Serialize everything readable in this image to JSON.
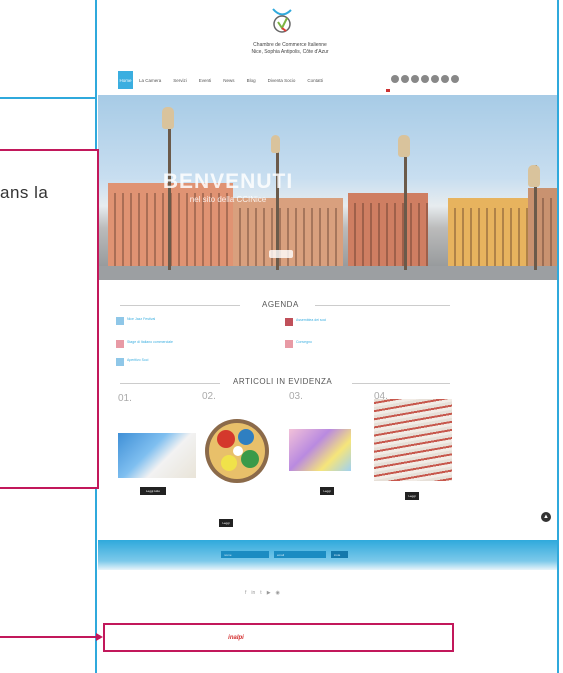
{
  "header": {
    "org_line1": "Chambre de Commerce Italienne",
    "org_line2": "Nice, Sophia Antipolis, Côte d'Azur",
    "nav": [
      "Home",
      "La Camera",
      "Servizi",
      "Eventi",
      "News",
      "Blog",
      "Diventa Socio",
      "Contatti"
    ]
  },
  "hero": {
    "title": "BENVENUTI",
    "subtitle": "nel sito della CCINice"
  },
  "sidebar_snippet": {
    "text": "ans la"
  },
  "agenda": {
    "title": "AGENDA",
    "items": [
      {
        "title": "Nice Jazz Festival",
        "meta": "",
        "color": "#8fc7e8"
      },
      {
        "title": "Stage di Italiano commerciale",
        "meta": "",
        "color": "#e89aa5"
      },
      {
        "title": "Aperitivo Soci",
        "meta": "",
        "color": "#8fc7e8"
      },
      {
        "title": "Assemblea dei soci",
        "meta": "",
        "color": "#c0505a"
      },
      {
        "title": "Convegno",
        "meta": "",
        "color": "#e89aa5"
      }
    ]
  },
  "articles": {
    "title": "ARTICOLI IN EVIDENZA",
    "items": [
      {
        "num": "01.",
        "title": "",
        "button": "Leggi tutto"
      },
      {
        "num": "02.",
        "title": "",
        "button": "Leggi"
      },
      {
        "num": "03.",
        "title": "",
        "button": "Leggi"
      },
      {
        "num": "04.",
        "title": "",
        "button": "Leggi"
      }
    ]
  },
  "newsletter": {
    "name_placeholder": "nome",
    "email_placeholder": "email",
    "submit": "invia"
  },
  "footer": {
    "contact_line1": "",
    "contact_line2": "",
    "address_line1": "",
    "address_line2": ""
  },
  "sponsors": [
    "",
    "",
    "",
    "",
    "inalpi",
    "",
    "",
    "",
    "",
    "",
    "",
    "",
    ""
  ],
  "colors": {
    "accent": "#2fa9dc",
    "highlight": "#c2185b"
  }
}
